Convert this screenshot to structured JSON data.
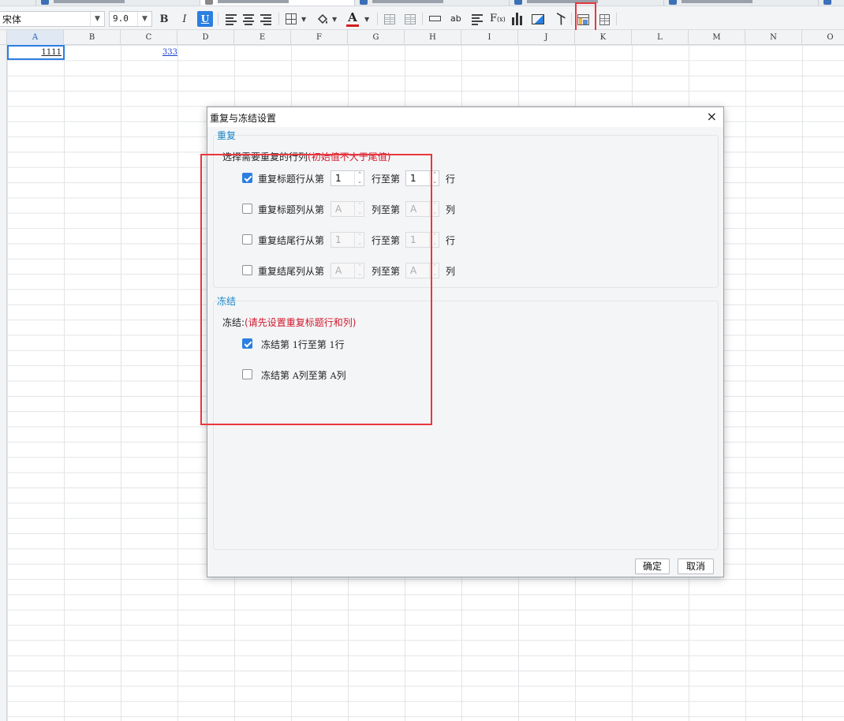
{
  "toolbar": {
    "font_name": "宋体",
    "font_size": "9.0",
    "bold_label": "B",
    "italic_label": "I",
    "underline_label": "U",
    "font_color_label": "A",
    "ab_label": "ab",
    "fx_label": "F",
    "fx_sub": "(x)",
    "colors": {
      "accent": "#2b7fe0",
      "highlight": "#e8373e",
      "font_color": "#d21e1e"
    }
  },
  "sheet": {
    "columns": [
      "A",
      "B",
      "C",
      "D",
      "E",
      "F",
      "G",
      "H",
      "I",
      "J",
      "K",
      "L",
      "M",
      "N",
      "O"
    ],
    "cells": {
      "A1": "1111",
      "C1": "333"
    }
  },
  "dialog": {
    "title": "重复与冻结设置",
    "close_icon": "×",
    "repeat": {
      "title": "重复",
      "hint": "选择需要重复的行列",
      "hint_note": "(初始值不大于尾值)",
      "rows": [
        {
          "checked": true,
          "label": "重复标题行从第",
          "from": "1",
          "mid": "行至第",
          "to": "1",
          "unit": "行",
          "enabled": true
        },
        {
          "checked": false,
          "label": "重复标题列从第",
          "from": "A",
          "mid": "列至第",
          "to": "A",
          "unit": "列",
          "enabled": false
        },
        {
          "checked": false,
          "label": "重复结尾行从第",
          "from": "1",
          "mid": "行至第",
          "to": "1",
          "unit": "行",
          "enabled": false
        },
        {
          "checked": false,
          "label": "重复结尾列从第",
          "from": "A",
          "mid": "列至第",
          "to": "A",
          "unit": "列",
          "enabled": false
        }
      ]
    },
    "freeze": {
      "title": "冻结",
      "hint": "冻结:",
      "hint_note": "(请先设置重复标题行和列)",
      "rows": [
        {
          "checked": true,
          "p1": "冻结第 ",
          "v1": "1",
          "p2": "行至第 ",
          "v2": "1",
          "p3": "行"
        },
        {
          "checked": false,
          "p1": "冻结第 ",
          "v1": "A",
          "p2": "列至第 ",
          "v2": "A",
          "p3": "列"
        }
      ]
    },
    "ok_label": "确定",
    "cancel_label": "取消"
  }
}
